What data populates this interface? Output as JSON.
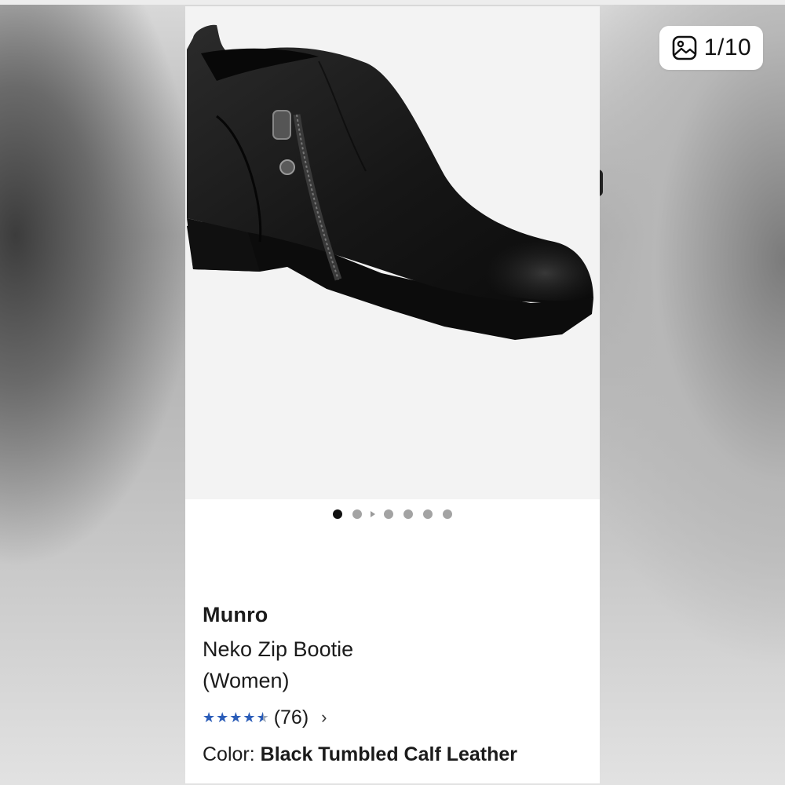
{
  "viewer": {
    "counter": "1/10",
    "counter_icon": "image-icon"
  },
  "product": {
    "brand": "Munro",
    "name_line1": "Neko Zip Bootie",
    "name_line2": "(Women)",
    "rating": 4.5,
    "rating_max": 5,
    "review_count": "(76)",
    "color_label": "Color:",
    "color_value": "Black Tumbled Calf Leather",
    "image_alt_icon": "black-ankle-boot-photo"
  },
  "carousel": {
    "dot_count": 7,
    "active_index": 0,
    "has_video_marker_after": 1
  },
  "colors": {
    "star": "#2a5cb8",
    "text": "#1b1b1b",
    "active_dot": "#111111",
    "inactive_dot": "#a3a3a3"
  }
}
